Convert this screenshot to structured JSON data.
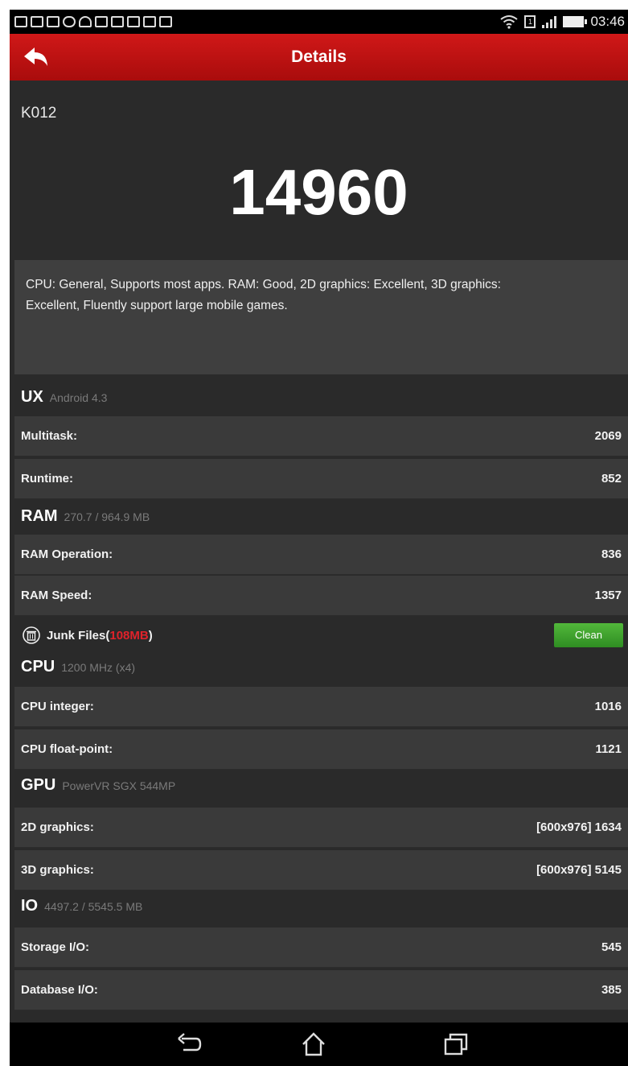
{
  "status_bar": {
    "time": "03:46",
    "sim_label": "1",
    "notification_icons": [
      "app-icon",
      "message-icon",
      "mail-icon",
      "pin-icon",
      "cloud-icon",
      "gallery-icon",
      "download-icon",
      "download-icon",
      "download-icon",
      "download-icon"
    ]
  },
  "header": {
    "title": "Details"
  },
  "device": {
    "name": "K012"
  },
  "score": "14960",
  "description": "CPU: General, Supports most apps. RAM: Good, 2D graphics: Excellent, 3D graphics: Excellent, Fluently support large mobile games.",
  "sections": {
    "ux": {
      "title": "UX",
      "subtitle": "Android 4.3",
      "rows": [
        {
          "label": "Multitask:",
          "value": "2069"
        },
        {
          "label": "Runtime:",
          "value": "852"
        }
      ]
    },
    "ram": {
      "title": "RAM",
      "subtitle": "270.7 / 964.9 MB",
      "rows": [
        {
          "label": "RAM Operation:",
          "value": "836"
        },
        {
          "label": "RAM Speed:",
          "value": "1357"
        }
      ],
      "junk": {
        "label": "Junk Files(",
        "size": "108MB",
        "suffix": ")",
        "button": "Clean"
      }
    },
    "cpu": {
      "title": "CPU",
      "subtitle": "1200 MHz (x4)",
      "rows": [
        {
          "label": "CPU integer:",
          "value": "1016"
        },
        {
          "label": "CPU float-point:",
          "value": "1121"
        }
      ]
    },
    "gpu": {
      "title": "GPU",
      "subtitle": "PowerVR SGX 544MP",
      "rows": [
        {
          "label": "2D graphics:",
          "value": "[600x976] 1634"
        },
        {
          "label": "3D graphics:",
          "value": "[600x976] 5145"
        }
      ]
    },
    "io": {
      "title": "IO",
      "subtitle": "4497.2 / 5545.5 MB",
      "rows": [
        {
          "label": "Storage I/O:",
          "value": "545"
        },
        {
          "label": "Database I/O:",
          "value": "385"
        }
      ]
    }
  },
  "colors": {
    "header_red": "#c01414",
    "junk_size_red": "#e0222a",
    "clean_green": "#3fa32e"
  }
}
